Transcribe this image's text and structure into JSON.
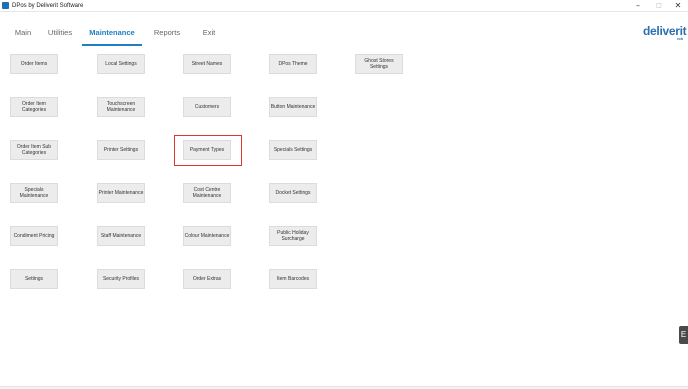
{
  "window": {
    "title": "DPos by Deliverit Software",
    "minimize_glyph": "–",
    "maximize_glyph": "□",
    "close_glyph": "✕"
  },
  "tabs": [
    {
      "label": "Main",
      "active": false
    },
    {
      "label": "Utilities",
      "active": false
    },
    {
      "label": "Maintenance",
      "active": true
    },
    {
      "label": "Reports",
      "active": false
    },
    {
      "label": "Exit",
      "active": false
    }
  ],
  "logo": {
    "text": "deliverit",
    "sub": "ecb",
    "color": "#2a6fb0"
  },
  "accent_color": "#1f7fc0",
  "highlight_color": "#e0362c",
  "highlighted_button": "Payment Types",
  "buttons": {
    "order_items": "Order Items",
    "local_settings": "Local Settings",
    "street_names": "Street Names",
    "dpos_theme": "DPos Theme",
    "ghost_stores_settings": "Ghost Stores Settings",
    "order_item_categories": "Order Item Categories",
    "touchscreen_maintenance": "Touchscreen Maintenance",
    "customers": "Customers",
    "button_maintenance": "Button Maintenance",
    "order_item_sub_categories": "Order Item Sub Categories",
    "printer_settings": "Printer Settings",
    "payment_types": "Payment Types",
    "specials_settings": "Specials Settings",
    "specials_maintenance": "Specials Maintenance",
    "printer_maintenance": "Printer Maintenance",
    "cost_centre_maintenance": "Cost Centre Maintenance",
    "docket_settings": "Docket Settings",
    "condiment_pricing": "Condiment Pricing",
    "staff_maintenance": "Staff Maintenance",
    "colour_maintenance": "Colour Maintenance",
    "public_holiday_surcharge": "Public Holiday Surcharge",
    "settings": "Settings",
    "security_profiles": "Security Profiles",
    "order_extras": "Order Extras",
    "item_barcodes": "Item Barcodes"
  },
  "side_tab_glyph": "E"
}
